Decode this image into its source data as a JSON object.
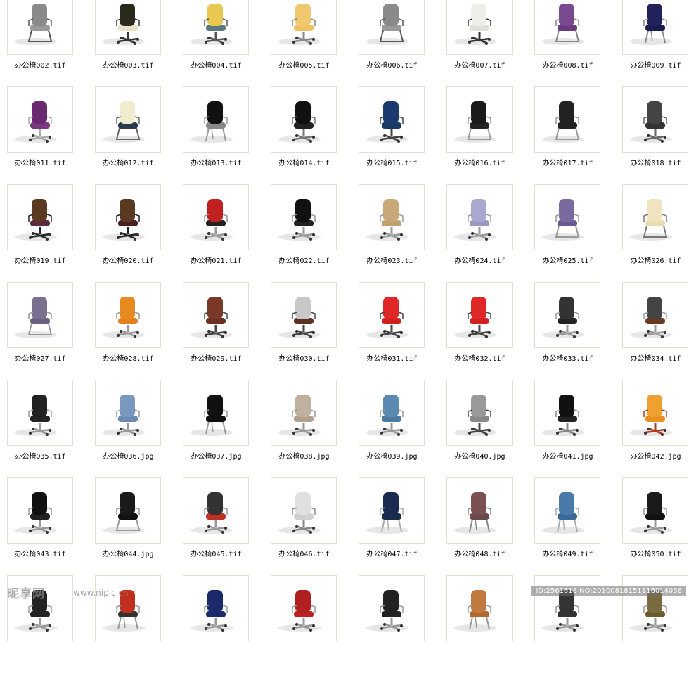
{
  "files": [
    {
      "name": "办公椅002.tif",
      "chair": {
        "seat": "#9a9a9a",
        "back": "#8a8a8a",
        "frame": "#555555",
        "base": "sled"
      }
    },
    {
      "name": "办公椅003.tif",
      "chair": {
        "seat": "#e8e0c8",
        "back": "#2a2a1c",
        "frame": "#333333",
        "base": "star"
      }
    },
    {
      "name": "办公椅004.tif",
      "chair": {
        "seat": "#5a7a80",
        "back": "#e8c850",
        "frame": "#555555",
        "base": "star"
      }
    },
    {
      "name": "办公椅005.tif",
      "chair": {
        "seat": "#f0c060",
        "back": "#f0c870",
        "frame": "#888888",
        "base": "star"
      }
    },
    {
      "name": "办公椅006.tif",
      "chair": {
        "seat": "#9a9a9a",
        "back": "#8a8a8a",
        "frame": "#555555",
        "base": "sled"
      }
    },
    {
      "name": "办公椅007.tif",
      "chair": {
        "seat": "#e0e0d8",
        "back": "#eeeeea",
        "frame": "#333333",
        "base": "star"
      }
    },
    {
      "name": "办公椅008.tif",
      "chair": {
        "seat": "#6a3a80",
        "back": "#7a4a90",
        "frame": "#888888",
        "base": "sled"
      }
    },
    {
      "name": "办公椅009.tif",
      "chair": {
        "seat": "#1a1a50",
        "back": "#22225a",
        "frame": "#888888",
        "base": "legs"
      }
    },
    {
      "name": "办公椅011.tif",
      "chair": {
        "seat": "#7a3a80",
        "back": "#6a2a70",
        "frame": "#aaaaaa",
        "base": "star"
      }
    },
    {
      "name": "办公椅012.tif",
      "chair": {
        "seat": "#2a3a50",
        "back": "#f0ecd0",
        "frame": "#666666",
        "base": "sled"
      }
    },
    {
      "name": "办公椅013.tif",
      "chair": {
        "seat": "#888888",
        "back": "#111111",
        "frame": "#999999",
        "base": "legs"
      }
    },
    {
      "name": "办公椅014.tif",
      "chair": {
        "seat": "#222222",
        "back": "#111111",
        "frame": "#777777",
        "base": "star"
      }
    },
    {
      "name": "办公椅015.tif",
      "chair": {
        "seat": "#1a3a6a",
        "back": "#1a3a70",
        "frame": "#444444",
        "base": "star"
      }
    },
    {
      "name": "办公椅016.tif",
      "chair": {
        "seat": "#222222",
        "back": "#1a1a1a",
        "frame": "#999999",
        "base": "sled"
      }
    },
    {
      "name": "办公椅017.tif",
      "chair": {
        "seat": "#222222",
        "back": "#222222",
        "frame": "#999999",
        "base": "sled"
      }
    },
    {
      "name": "办公椅018.tif",
      "chair": {
        "seat": "#333333",
        "back": "#444444",
        "frame": "#666666",
        "base": "star"
      }
    },
    {
      "name": "办公椅019.tif",
      "chair": {
        "seat": "#5a2a40",
        "back": "#5a3a20",
        "frame": "#222222",
        "base": "star"
      }
    },
    {
      "name": "办公椅020.tif",
      "chair": {
        "seat": "#4a2020",
        "back": "#5a3a20",
        "frame": "#222222",
        "base": "star"
      }
    },
    {
      "name": "办公椅021.tif",
      "chair": {
        "seat": "#222222",
        "back": "#c02020",
        "frame": "#999999",
        "base": "star"
      }
    },
    {
      "name": "办公椅022.tif",
      "chair": {
        "seat": "#222222",
        "back": "#111111",
        "frame": "#999999",
        "base": "star"
      }
    },
    {
      "name": "办公椅023.tif",
      "chair": {
        "seat": "#c0a070",
        "back": "#c8a878",
        "frame": "#999999",
        "base": "star"
      }
    },
    {
      "name": "办公椅024.tif",
      "chair": {
        "seat": "#9a9ac0",
        "back": "#a8a8d0",
        "frame": "#999999",
        "base": "star"
      }
    },
    {
      "name": "办公椅025.tif",
      "chair": {
        "seat": "#6a5a90",
        "back": "#7a6aa0",
        "frame": "#999999",
        "base": "sled"
      }
    },
    {
      "name": "办公椅026.tif",
      "chair": {
        "seat": "#e8dcb0",
        "back": "#f0e4c0",
        "frame": "#777777",
        "base": "sled"
      }
    },
    {
      "name": "办公椅027.tif",
      "chair": {
        "seat": "#6a6080",
        "back": "#7a7090",
        "frame": "#999999",
        "base": "sled"
      }
    },
    {
      "name": "办公椅028.tif",
      "chair": {
        "seat": "#e08020",
        "back": "#e88a20",
        "frame": "#999999",
        "base": "star"
      }
    },
    {
      "name": "办公椅029.tif",
      "chair": {
        "seat": "#6a3020",
        "back": "#7a3828",
        "frame": "#444444",
        "base": "star"
      }
    },
    {
      "name": "办公椅030.tif",
      "chair": {
        "seat": "#5a3020",
        "back": "#c8c8c8",
        "frame": "#444444",
        "base": "star"
      }
    },
    {
      "name": "办公椅031.tif",
      "chair": {
        "seat": "#d02020",
        "back": "#e02828",
        "frame": "#444444",
        "base": "star"
      }
    },
    {
      "name": "办公椅032.tif",
      "chair": {
        "seat": "#d02020",
        "back": "#e02828",
        "frame": "#444444",
        "base": "star"
      }
    },
    {
      "name": "办公椅033.tif",
      "chair": {
        "seat": "#222222",
        "back": "#333333",
        "frame": "#999999",
        "base": "star"
      }
    },
    {
      "name": "办公椅034.tif",
      "chair": {
        "seat": "#6a3a20",
        "back": "#444444",
        "frame": "#999999",
        "base": "star"
      }
    },
    {
      "name": "办公椅035.tif",
      "chair": {
        "seat": "#222222",
        "back": "#222222",
        "frame": "#999999",
        "base": "star"
      }
    },
    {
      "name": "办公椅036.jpg",
      "chair": {
        "seat": "#6a8ab0",
        "back": "#7898c0",
        "frame": "#999999",
        "base": "star"
      }
    },
    {
      "name": "办公椅037.jpg",
      "chair": {
        "seat": "#111111",
        "back": "#111111",
        "frame": "#999999",
        "base": "legs"
      }
    },
    {
      "name": "办公椅038.jpg",
      "chair": {
        "seat": "#b0a090",
        "back": "#c0b0a0",
        "frame": "#999999",
        "base": "star"
      }
    },
    {
      "name": "办公椅039.jpg",
      "chair": {
        "seat": "#4a7aa0",
        "back": "#5a8ab0",
        "frame": "#999999",
        "base": "star"
      }
    },
    {
      "name": "办公椅040.jpg",
      "chair": {
        "seat": "#888888",
        "back": "#999999",
        "frame": "#444444",
        "base": "star"
      }
    },
    {
      "name": "办公椅041.jpg",
      "chair": {
        "seat": "#222222",
        "back": "#111111",
        "frame": "#888888",
        "base": "star"
      }
    },
    {
      "name": "办公椅042.jpg",
      "chair": {
        "seat": "#e89020",
        "back": "#f0a030",
        "frame": "#aa4020",
        "base": "star"
      }
    },
    {
      "name": "办公椅043.tif",
      "chair": {
        "seat": "#222222",
        "back": "#111111",
        "frame": "#999999",
        "base": "star"
      }
    },
    {
      "name": "办公椅044.jpg",
      "chair": {
        "seat": "#111111",
        "back": "#1a1a1a",
        "frame": "#999999",
        "base": "sled"
      }
    },
    {
      "name": "办公椅045.tif",
      "chair": {
        "seat": "#c03020",
        "back": "#333333",
        "frame": "#999999",
        "base": "star"
      }
    },
    {
      "name": "办公椅046.tif",
      "chair": {
        "seat": "#d0d0d0",
        "back": "#e0e0e0",
        "frame": "#888888",
        "base": "star"
      }
    },
    {
      "name": "办公椅047.tif",
      "chair": {
        "seat": "#1a2a4a",
        "back": "#1a2a50",
        "frame": "#aaaaaa",
        "base": "legs"
      }
    },
    {
      "name": "办公椅048.tif",
      "chair": {
        "seat": "#6a4a4a",
        "back": "#7a5050",
        "frame": "#888888",
        "base": "legs"
      }
    },
    {
      "name": "办公椅049.tif",
      "chair": {
        "seat": "#3a6a9a",
        "back": "#4a7aaa",
        "frame": "#aaaaaa",
        "base": "legs"
      }
    },
    {
      "name": "办公椅050.tif",
      "chair": {
        "seat": "#111111",
        "back": "#1a1a1a",
        "frame": "#999999",
        "base": "star"
      }
    },
    {
      "name": "",
      "chair": {
        "seat": "#222222",
        "back": "#222222",
        "frame": "#999999",
        "base": "star"
      }
    },
    {
      "name": "",
      "chair": {
        "seat": "#333333",
        "back": "#c03020",
        "frame": "#999999",
        "base": "legs"
      }
    },
    {
      "name": "",
      "chair": {
        "seat": "#1a2a6a",
        "back": "#1a2a6a",
        "frame": "#999999",
        "base": "star"
      }
    },
    {
      "name": "",
      "chair": {
        "seat": "#c02020",
        "back": "#b02020",
        "frame": "#999999",
        "base": "star"
      }
    },
    {
      "name": "",
      "chair": {
        "seat": "#222222",
        "back": "#222222",
        "frame": "#999999",
        "base": "star"
      }
    },
    {
      "name": "",
      "chair": {
        "seat": "#b06a30",
        "back": "#c07a40",
        "frame": "#999999",
        "base": "legs"
      }
    },
    {
      "name": "",
      "chair": {
        "seat": "#333333",
        "back": "#333333",
        "frame": "#999999",
        "base": "star"
      }
    },
    {
      "name": "",
      "chair": {
        "seat": "#6a5a30",
        "back": "#7a6a40",
        "frame": "#999999",
        "base": "star"
      }
    }
  ],
  "watermark": {
    "site": "昵享网",
    "url": "www.nipic.cn",
    "id_text": "ID:2561618 NO:20100818151116014036"
  }
}
